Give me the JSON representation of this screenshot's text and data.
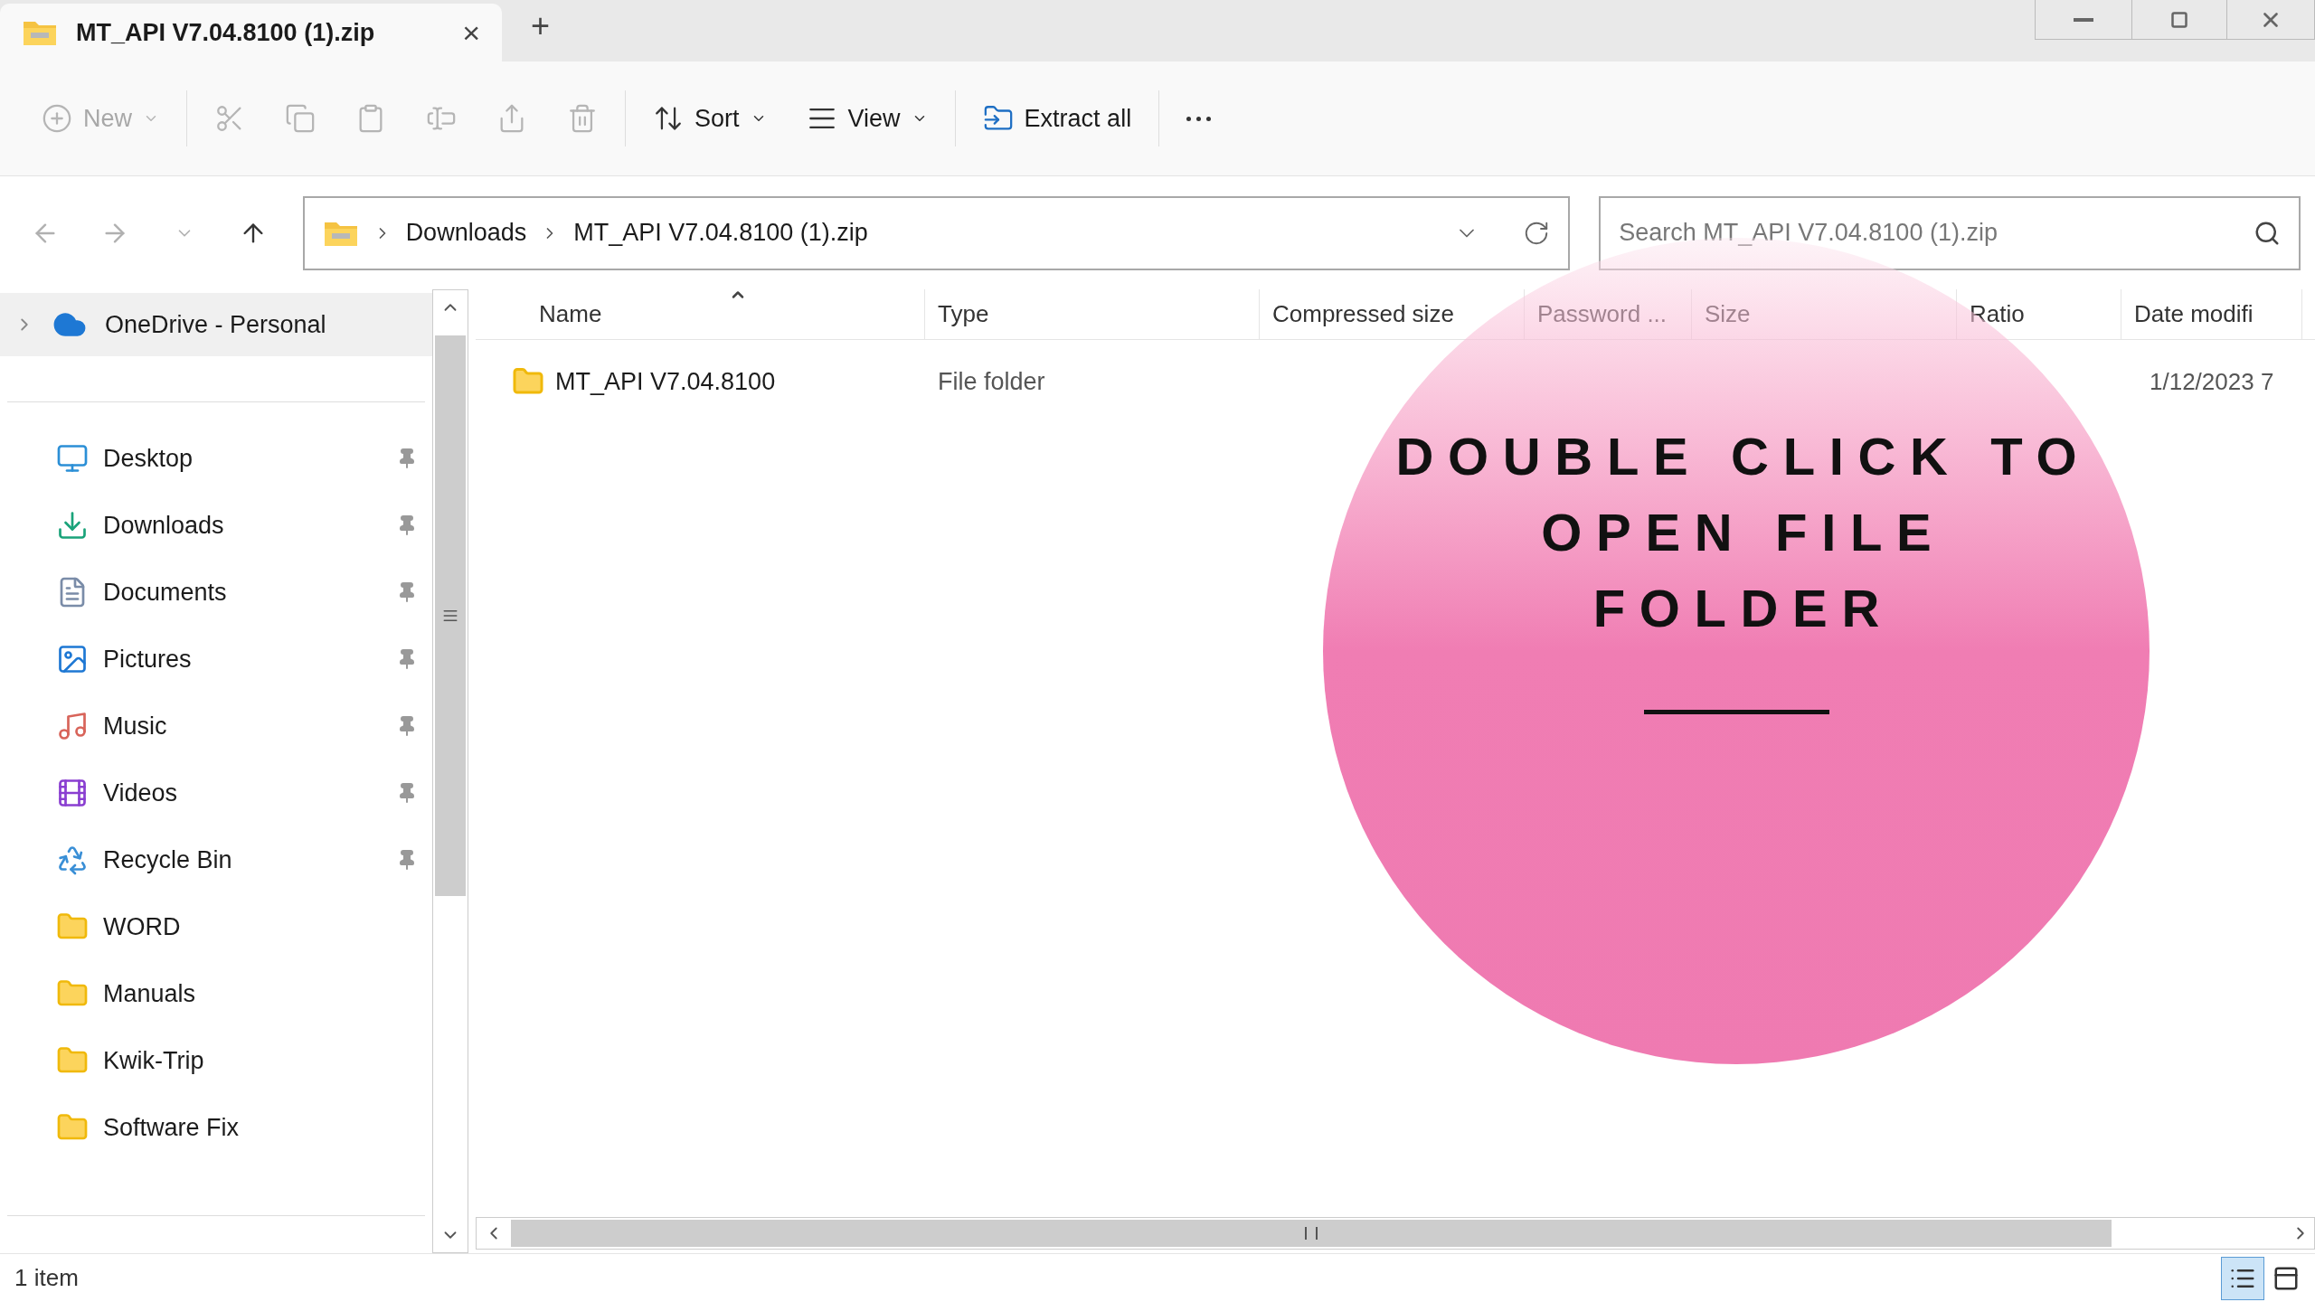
{
  "tab": {
    "title": "MT_API V7.04.8100 (1).zip",
    "close": "×",
    "selected": true
  },
  "new_tab": "+",
  "toolbar": [
    {
      "kind": "new",
      "label": "New",
      "disabled": true
    },
    {
      "kind": "cut",
      "disabled": true
    },
    {
      "kind": "copy",
      "disabled": true
    },
    {
      "kind": "paste",
      "disabled": true
    },
    {
      "kind": "rename",
      "disabled": true
    },
    {
      "kind": "share",
      "disabled": true
    },
    {
      "kind": "delete",
      "disabled": true
    },
    {
      "kind": "sort",
      "label": "Sort",
      "disabled": false
    },
    {
      "kind": "view",
      "label": "View",
      "disabled": false
    },
    {
      "kind": "extract",
      "label": "Extract all",
      "disabled": false
    },
    {
      "kind": "more",
      "disabled": false
    }
  ],
  "nav": [
    {
      "kind": "back",
      "disabled": true
    },
    {
      "kind": "forward",
      "disabled": true
    },
    {
      "kind": "recent",
      "disabled": true
    },
    {
      "kind": "up",
      "disabled": false
    }
  ],
  "address": {
    "crumbs": [
      "Downloads",
      "MT_API V7.04.8100 (1).zip"
    ]
  },
  "search": {
    "placeholder": "Search MT_API V7.04.8100 (1).zip"
  },
  "sidebar": {
    "top": {
      "label": "OneDrive - Personal",
      "expanded": false,
      "selected": true
    },
    "items": [
      {
        "kind": "desktop",
        "label": "Desktop",
        "pinned": true
      },
      {
        "kind": "downloads",
        "label": "Downloads",
        "pinned": true
      },
      {
        "kind": "documents",
        "label": "Documents",
        "pinned": true
      },
      {
        "kind": "pictures",
        "label": "Pictures",
        "pinned": true
      },
      {
        "kind": "music",
        "label": "Music",
        "pinned": true
      },
      {
        "kind": "videos",
        "label": "Videos",
        "pinned": true
      },
      {
        "kind": "recycle",
        "label": "Recycle Bin",
        "pinned": true
      },
      {
        "kind": "folder",
        "label": "WORD",
        "pinned": false
      },
      {
        "kind": "folder",
        "label": "Manuals",
        "pinned": false
      },
      {
        "kind": "folder",
        "label": "Kwik-Trip",
        "pinned": false
      },
      {
        "kind": "folder",
        "label": "Software Fix",
        "pinned": false
      }
    ]
  },
  "table": {
    "columns": [
      {
        "label": "Name",
        "sorted": true
      },
      {
        "label": "Type",
        "sorted": false
      },
      {
        "label": "Compressed size",
        "sorted": false
      },
      {
        "label": "Password ...",
        "sorted": false
      },
      {
        "label": "Size",
        "sorted": false
      },
      {
        "label": "Ratio",
        "sorted": false
      },
      {
        "label": "Date modifi",
        "sorted": false
      }
    ],
    "rows": [
      {
        "name": "MT_API V7.04.8100",
        "type": "File folder",
        "date": "1/12/2023 7"
      }
    ]
  },
  "status_bar": {
    "count": "1 item"
  },
  "view_modes": [
    {
      "kind": "details",
      "selected": true
    },
    {
      "kind": "tiles",
      "selected": false
    }
  ],
  "callout": {
    "lines": [
      "DOUBLE CLICK TO",
      "OPEN FILE",
      "FOLDER"
    ]
  }
}
